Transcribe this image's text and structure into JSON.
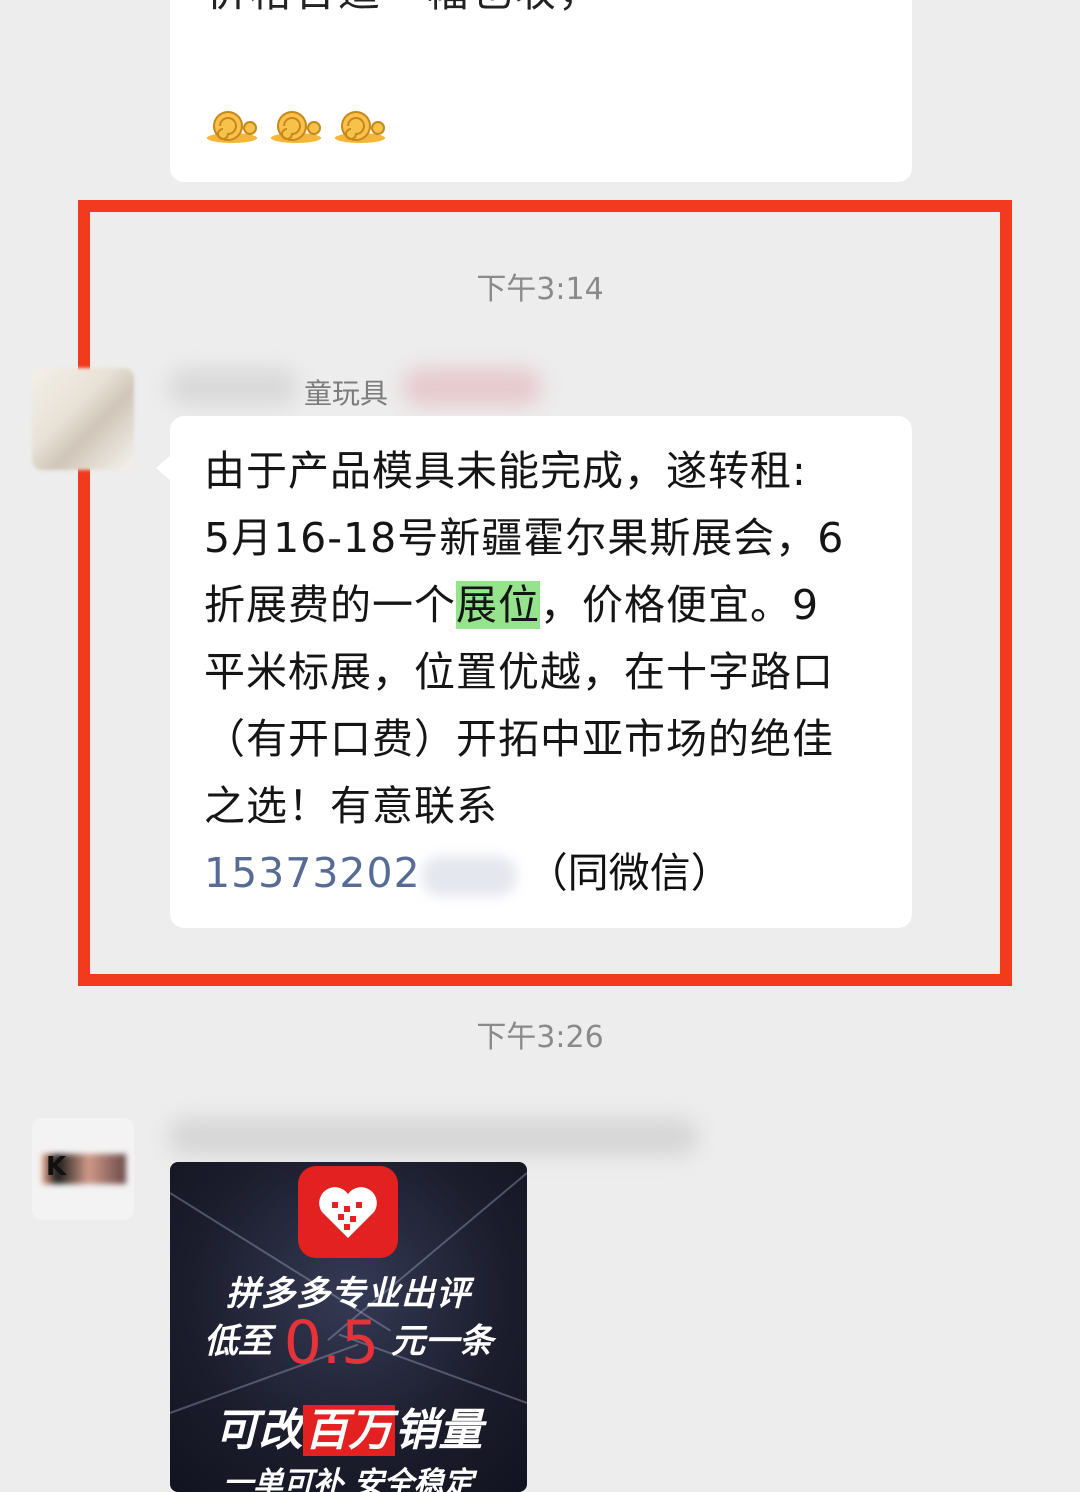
{
  "top_message": {
    "cut_text": "价格合适一幅也收，",
    "emoji": [
      "snail-emoji",
      "snail-emoji",
      "snail-emoji"
    ]
  },
  "message_1": {
    "timestamp": "下午3:14",
    "sender_visible": "童玩具",
    "lines": [
      "由于产品模具未能完成，遂转租:",
      "5月16-18号新疆霍尔果斯展会，6",
      "折展费的一个",
      "展位",
      "，价格便宜。9",
      "平米标展，位置优越，在十字路口",
      "（有开口费）开拓中亚市场的绝佳",
      "之选！有意联系"
    ],
    "phone_visible": "15373202",
    "phone_suffix": "（同微信）"
  },
  "message_2": {
    "timestamp": "下午3:26",
    "avatar_letter": "K",
    "image_ad": {
      "line1": "拼多多专业出评",
      "line2_pre": "低至",
      "line2_num": "0.5",
      "line2_post": "元一条",
      "line3_pre": "可改",
      "line3_red": "百万",
      "line3_post": "销量",
      "line4": "一单可补 安全稳定"
    }
  },
  "colors": {
    "background": "#ededed",
    "bubble": "#ffffff",
    "highlight_frame": "#f23a1f",
    "keyword_highlight": "#95e38d",
    "phone_link": "#576b95",
    "timestamp": "#8a8a8a"
  }
}
